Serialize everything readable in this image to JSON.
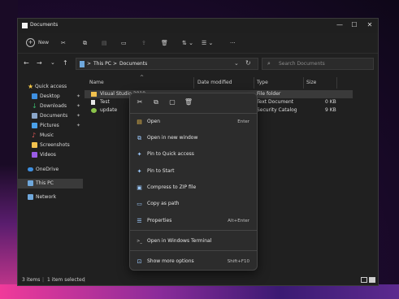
{
  "window": {
    "title": "Documents",
    "controls": {
      "minimize": "—",
      "maximize": "☐",
      "close": "✕"
    }
  },
  "toolbar": {
    "new_label": "New",
    "more": "···",
    "sort_symbol": "⇅",
    "view_symbol": "☰",
    "chevron": "⌄"
  },
  "address": {
    "crumbs": [
      "This PC",
      "Documents"
    ],
    "separator": ">",
    "search_placeholder": "Search Documents"
  },
  "sidebar": {
    "items": [
      {
        "label": "Quick access",
        "icon": "star-icon",
        "color": "#f7c948"
      },
      {
        "label": "Desktop",
        "icon": "desktop-icon",
        "color": "#3d8fe0",
        "pinned": true
      },
      {
        "label": "Downloads",
        "icon": "download-icon",
        "color": "#3ab76b",
        "pinned": true
      },
      {
        "label": "Documents",
        "icon": "document-icon",
        "color": "#8aa6c8",
        "pinned": true
      },
      {
        "label": "Pictures",
        "icon": "pictures-icon",
        "color": "#4aa0e8",
        "pinned": true
      },
      {
        "label": "Music",
        "icon": "music-icon",
        "color": "#e85a5a"
      },
      {
        "label": "Screenshots",
        "icon": "folder-icon",
        "color": "#f2c14e"
      },
      {
        "label": "Videos",
        "icon": "videos-icon",
        "color": "#9a5ce6"
      },
      {
        "label": "OneDrive",
        "icon": "cloud-icon",
        "color": "#3d8fe0"
      },
      {
        "label": "This PC",
        "icon": "pc-icon",
        "color": "#6fa8dc",
        "selected": true
      },
      {
        "label": "Network",
        "icon": "network-icon",
        "color": "#6fa8dc"
      }
    ]
  },
  "columns": {
    "name": "Name",
    "date": "Date modified",
    "type": "Type",
    "size": "Size"
  },
  "files": [
    {
      "name": "Visual Studio 2019",
      "date": "",
      "type": "File folder",
      "size": "",
      "icon": "folder-icon",
      "selected": true
    },
    {
      "name": "Test",
      "date": "",
      "type": "Text Document",
      "size": "0 KB",
      "icon": "text-file-icon"
    },
    {
      "name": "update",
      "date": "",
      "type": "Security Catalog",
      "size": "9 KB",
      "icon": "catalog-icon"
    }
  ],
  "status": {
    "count": "3 items",
    "selected": "1 item selected"
  },
  "context_menu": {
    "top_icons": [
      "cut-icon",
      "copy-icon",
      "rename-icon",
      "delete-icon"
    ],
    "top_glyphs": [
      "✂",
      "⧉",
      "▢",
      "🗑"
    ],
    "items": [
      {
        "label": "Open",
        "shortcut": "Enter",
        "icon": "open-icon",
        "glyph": "▤"
      },
      {
        "label": "Open in new window",
        "shortcut": "",
        "icon": "new-window-icon",
        "glyph": "⧉"
      },
      {
        "label": "Pin to Quick access",
        "shortcut": "",
        "icon": "pin-icon",
        "glyph": "✦"
      },
      {
        "label": "Pin to Start",
        "shortcut": "",
        "icon": "pin-icon",
        "glyph": "✦"
      },
      {
        "label": "Compress to ZIP file",
        "shortcut": "",
        "icon": "zip-icon",
        "glyph": "▣"
      },
      {
        "label": "Copy as path",
        "shortcut": "",
        "icon": "copy-path-icon",
        "glyph": "▭"
      },
      {
        "label": "Properties",
        "shortcut": "Alt+Enter",
        "icon": "properties-icon",
        "glyph": "☰"
      },
      {
        "label": "Open in Windows Terminal",
        "shortcut": "",
        "icon": "terminal-icon",
        "glyph": ">_"
      },
      {
        "label": "Show more options",
        "shortcut": "Shift+F10",
        "icon": "more-options-icon",
        "glyph": "⊡"
      }
    ]
  }
}
